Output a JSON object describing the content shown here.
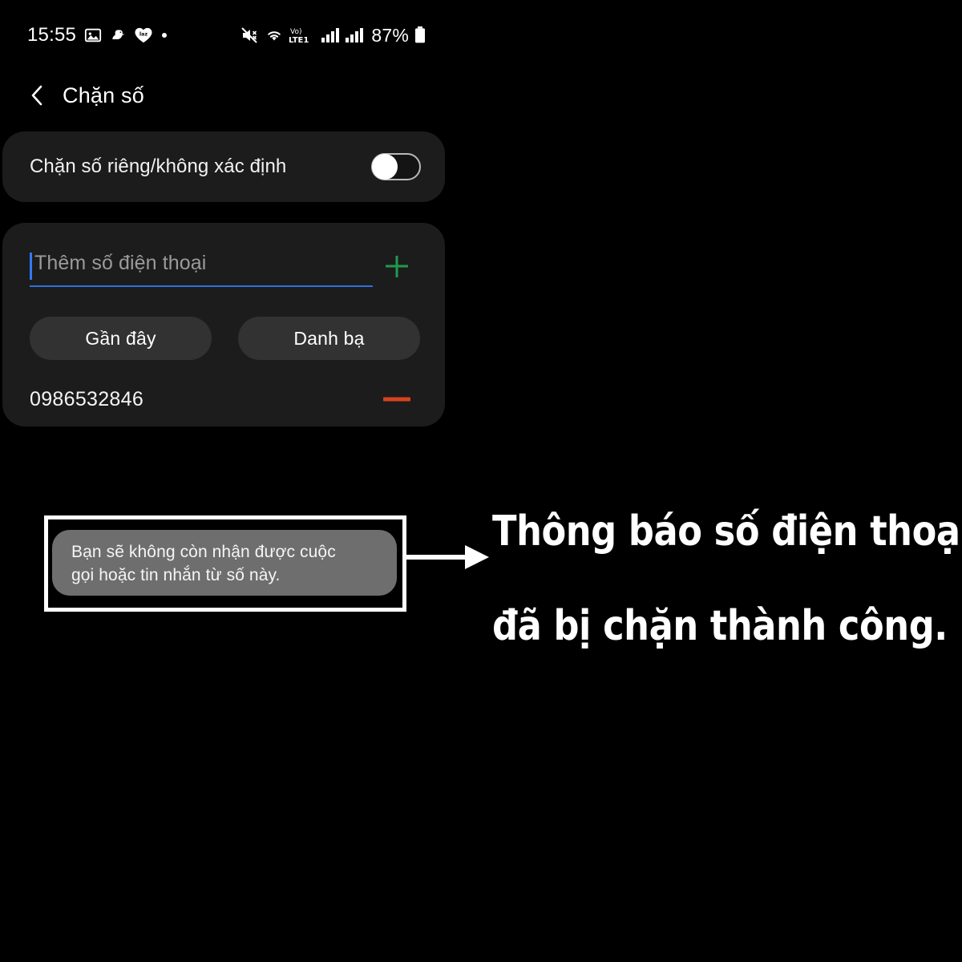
{
  "status_bar": {
    "time": "15:55",
    "left_icons": [
      "image-icon",
      "duck-icon",
      "lazada-heart-icon",
      "dot-icon"
    ],
    "right_icons": [
      "mute-icon",
      "wifi-icon",
      "volte1-icon",
      "signal-sim1-icon",
      "signal-sim2-icon"
    ],
    "network_label": "Vo) LTE1",
    "battery_percent": "87%"
  },
  "app_bar": {
    "back_icon": "chevron-left-icon",
    "title": "Chặn số"
  },
  "block_unknown": {
    "label": "Chặn số riêng/không xác định",
    "toggle_state": "off"
  },
  "add_number": {
    "placeholder": "Thêm số điện thoại",
    "value": "",
    "add_icon": "plus-icon",
    "accent_color": "#2f6fdf",
    "add_icon_color": "#1f9a4e"
  },
  "source_buttons": [
    {
      "label": "Gần đây"
    },
    {
      "label": "Danh bạ"
    }
  ],
  "blocked_numbers": [
    {
      "number": "0986532846",
      "remove_icon": "minus-icon",
      "remove_color": "#d9431f"
    }
  ],
  "toast": {
    "message": "Bạn sẽ không còn nhận được cuộc gọi hoặc tin nhắn từ số này.",
    "line1": "Bạn sẽ không còn nhận được cuộc",
    "line2": "gọi hoặc tin nhắn từ số này.",
    "background": "#6e6e6e"
  },
  "annotation": {
    "arrow_icon": "arrow-right-icon",
    "line1": "Thông báo số điện thoại",
    "line2": "đã bị chặn thành công.",
    "color": "#ffffff"
  }
}
